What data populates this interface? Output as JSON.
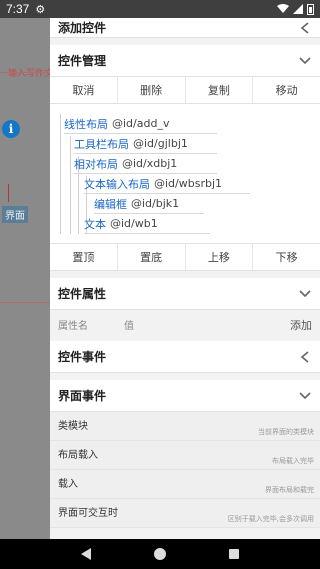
{
  "status_bar": {
    "time": "7:37"
  },
  "background": {
    "hint_text": "输入写作文",
    "iface_label": "界面"
  },
  "sections": {
    "add_control": {
      "title": "添加控件"
    },
    "control_manage": {
      "title": "控件管理",
      "top_buttons": [
        "取消",
        "删除",
        "复制",
        "移动"
      ],
      "tree": [
        {
          "name": "线性布局",
          "id": "@id/add_v"
        },
        {
          "name": "工具栏布局",
          "id": "@id/gjlbj1"
        },
        {
          "name": "相对布局",
          "id": "@id/xdbj1"
        },
        {
          "name": "文本输入布局",
          "id": "@id/wbsrbj1"
        },
        {
          "name": "编辑框",
          "id": "@id/bjk1"
        },
        {
          "name": "文本",
          "id": "@id/wb1"
        }
      ],
      "bottom_buttons": [
        "置顶",
        "置底",
        "上移",
        "下移"
      ]
    },
    "control_props": {
      "title": "控件属性",
      "attr_placeholder": "属性名",
      "value_placeholder": "值",
      "add_label": "添加"
    },
    "control_events": {
      "title": "控件事件"
    },
    "interface_events": {
      "title": "界面事件",
      "items": [
        {
          "label": "类模块",
          "hint": "当前界面的类模块"
        },
        {
          "label": "布局载入",
          "hint": "布局载入完毕"
        },
        {
          "label": "载入",
          "hint": "界面布局和载完"
        },
        {
          "label": "界面可交互时",
          "hint": "区别于载入完毕,会多次调用"
        }
      ]
    }
  }
}
